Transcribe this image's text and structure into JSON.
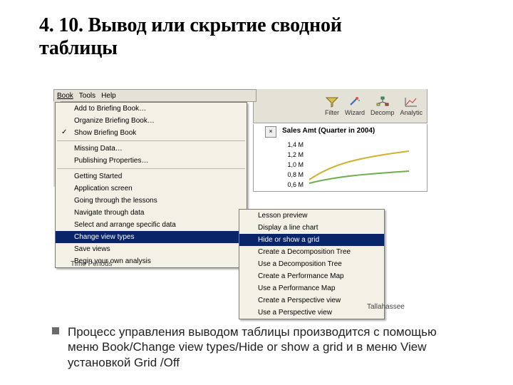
{
  "title_line1": "4. 10. Вывод или скрытие сводной",
  "title_line2": "таблицы",
  "menubar": {
    "book": "Book",
    "tools": "Tools",
    "help": "Help"
  },
  "toolbar": {
    "filter": "Filter",
    "wizard": "Wizard",
    "decomp": "Decomp",
    "analytics": "Analytic"
  },
  "chart": {
    "close": "×",
    "title": "Sales Amt (Quarter in 2004)",
    "y": [
      "1,4 M",
      "1,2 M",
      "1,0 M",
      "0,8 M",
      "0,6 M"
    ]
  },
  "menu": {
    "items": [
      "Add to Briefing Book…",
      "Organize Briefing Book…",
      "Show Briefing Book",
      "Missing Data…",
      "Publishing Properties…",
      "Getting Started",
      "Application screen",
      "Going through the lessons",
      "Navigate through data",
      "Select and arrange specific data",
      "Change view types",
      "Save views",
      "Begin your own analysis"
    ]
  },
  "submenu": {
    "items": [
      "Lesson preview",
      "Display a line chart",
      "Hide or show a grid",
      "Create a Decomposition Tree",
      "Use a Decomposition Tree",
      "Create a Performance Map",
      "Use a Performance Map",
      "Create a Perspective view",
      "Use a Perspective view"
    ]
  },
  "trailing": "Time Periods",
  "trailing2": "Tallahassee",
  "bullet_text": "Процесс управления выводом таблицы производится с помощью меню Book/Change view types/Hide or show a grid и в меню View  установкой Grid /Off"
}
